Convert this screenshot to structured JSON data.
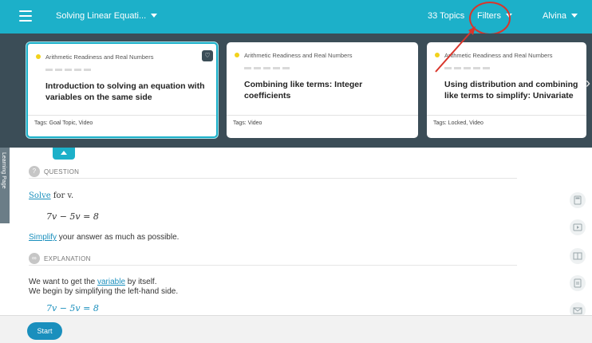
{
  "header": {
    "course_title": "Solving Linear Equati...",
    "topics_count": "33 Topics",
    "filters_label": "Filters",
    "user_name": "Alvina"
  },
  "cards": [
    {
      "unit": "Arithmetic Readiness and Real Numbers",
      "title": "Introduction to solving an equation with variables on the same side",
      "tags": "Tags: Goal Topic, Video",
      "selected": true
    },
    {
      "unit": "Arithmetic Readiness and Real Numbers",
      "title": "Combining like terms: Integer coefficients",
      "tags": "Tags: Video",
      "selected": false
    },
    {
      "unit": "Arithmetic Readiness and Real Numbers",
      "title": "Using distribution and combining like terms to simplify: Univariate",
      "tags": "Tags: Locked, Video",
      "selected": false
    }
  ],
  "side_tab_label": "Learning Page",
  "question": {
    "heading": "QUESTION",
    "instruction_link": "Solve",
    "instruction_rest": " for v.",
    "equation": "7v − 5v = 8",
    "simplify_link": "Simplify",
    "simplify_rest": " your answer as much as possible."
  },
  "explanation": {
    "heading": "EXPLANATION",
    "line1_pre": "We want to get the ",
    "line1_link": "variable",
    "line1_post": " by itself.",
    "line2": "We begin by simplifying the left-hand side.",
    "equation": "7v − 5v = 8"
  },
  "tools": [
    "calculator-icon",
    "video-icon",
    "book-icon",
    "notes-icon",
    "mail-icon"
  ],
  "start_label": "Start",
  "colors": {
    "brand": "#1cb0c9",
    "strip": "#3b4d57",
    "link": "#1a8fbd",
    "annotation": "#d9352b"
  }
}
